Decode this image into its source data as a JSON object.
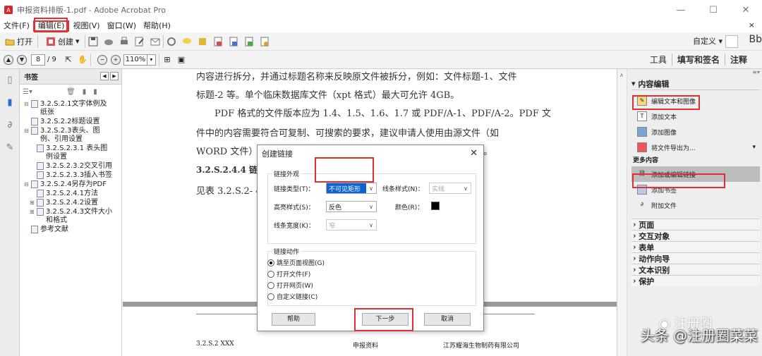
{
  "window": {
    "title": "申报资料排版-1.pdf - Adobe Acrobat Pro",
    "min": "—",
    "max": "☐",
    "close": "✕"
  },
  "menu": {
    "items": [
      "文件(F)",
      "编辑(E)",
      "视图(V)",
      "窗口(W)",
      "帮助(H)"
    ],
    "close": "×"
  },
  "toolbar": {
    "open_label": "打开",
    "create_label": "创建",
    "customize_label": "自定义",
    "right_text": "Bb"
  },
  "nav": {
    "page_current": "8",
    "page_total": "/ 9",
    "zoom": "110%"
  },
  "right_tabs": [
    "工具",
    "填写和签名",
    "注释"
  ],
  "bookmarks": {
    "header": "书签",
    "items": [
      {
        "toggle": "⊟",
        "label": "3.2.S.2.1文字体例及纸张"
      },
      {
        "toggle": "",
        "label": "3.2.S.2.2标题设置"
      },
      {
        "toggle": "⊟",
        "label": "3.2.S.2.3表头、图例、引用设置"
      },
      {
        "toggle": "",
        "label": "3.2.S.2.3.1 表头图例设置"
      },
      {
        "toggle": "",
        "label": "3.2.S.2.3.2交叉引用"
      },
      {
        "toggle": "",
        "label": "3.2.S.2.3.3插入书签"
      },
      {
        "toggle": "⊟",
        "label": "3.2.S.2.4另存为PDF"
      },
      {
        "toggle": "",
        "label": "3.2.S.2.4.1方法"
      },
      {
        "toggle": "⊞",
        "label": "3.2.S.2.4.2设置"
      },
      {
        "toggle": "⊞",
        "label": "3.2.S.2.4.3文件大小和格式"
      },
      {
        "toggle": "",
        "label": "参考文献"
      }
    ]
  },
  "document": {
    "lines": [
      "内容进行拆分，并通过标题名称来反映原文件被拆分，例如：文件标题-1、文件",
      "标题-2 等。单个临床数据库文件（xpt 格式）最大可允许 4GB。",
      "PDF 格式的文件版本应为 1.4、1.5、1.6、1.7 或 PDF/A-1、PDF/A-2。PDF 文",
      "件中的内容需要符合可复制、可搜索的要求，建议申请人使用由源文件（如",
      "WORD 文件）转化形成的 PDF 文件，而使用扫描件创建的 PDF 文件。",
      "3.2.S.2.4.4 链接",
      "见表 3.2.S.2- 4"
    ],
    "footer_left": "3.2.S.2 XXX",
    "footer_mid": "申报资料",
    "footer_right": "江苏耀海生物制药有限公司"
  },
  "dialog": {
    "title": "创建链接",
    "appearance_legend": "链接外观",
    "link_type_label": "链接类型(T)：",
    "link_type_value": "不可见矩形",
    "line_style_label": "线条样式(N)：",
    "line_style_value": "实线",
    "highlight_label": "高亮样式(S)：",
    "highlight_value": "反色",
    "color_label": "颜色(R)：",
    "line_width_label": "线条宽度(K)：",
    "line_width_value": "窄",
    "action_legend": "链接动作",
    "actions": [
      {
        "label": "跳至页面视图(G)",
        "checked": true
      },
      {
        "label": "打开文件(F)",
        "checked": false
      },
      {
        "label": "打开网页(W)",
        "checked": false
      },
      {
        "label": "自定义链接(C)",
        "checked": false
      }
    ],
    "help_button": "帮助",
    "next_button": "下一步",
    "cancel_button": "取消"
  },
  "right_panel": {
    "content_edit_title": "内容编辑",
    "content_items": [
      "编辑文本和图像",
      "添加文本",
      "添加图像",
      "将文件导出为..."
    ],
    "more_title": "更多内容",
    "more_items": [
      "添加或编辑链接",
      "添加书签",
      "附加文件"
    ],
    "collapsed": [
      "页面",
      "交互对象",
      "表单",
      "动作向导",
      "文本识别",
      "保护"
    ]
  },
  "watermark": {
    "logo": "注册圈",
    "text": "头条 @注册圈菜菜"
  }
}
